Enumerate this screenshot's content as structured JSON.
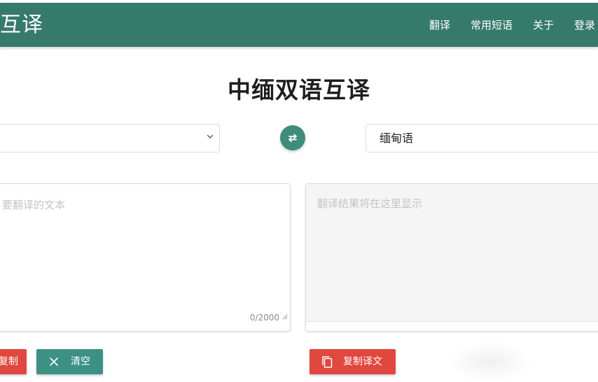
{
  "header": {
    "brand": "互译",
    "nav": [
      "翻译",
      "常用短语",
      "关于",
      "登录"
    ]
  },
  "main": {
    "title": "中缅双语互译",
    "source_language": "",
    "target_language": "缅甸语",
    "input": {
      "placeholder": "要翻译的文本",
      "value": "",
      "counter": "0/2000"
    },
    "output": {
      "placeholder": "翻译结果将在这里显示",
      "value": ""
    }
  },
  "actions": {
    "copy_source": "复制",
    "clear": "清空",
    "copy_translation": "复制译文"
  },
  "colors": {
    "primary": "#367a6b",
    "swap_button": "#3f8c7c",
    "danger": "#e0473e",
    "teal_button": "#3d9184"
  },
  "icons": {
    "swap": "swap-arrows-icon",
    "dropdown": "chevron-down-icon",
    "clear": "close-icon",
    "copy": "copy-icon",
    "resize": "resize-grip-icon"
  }
}
